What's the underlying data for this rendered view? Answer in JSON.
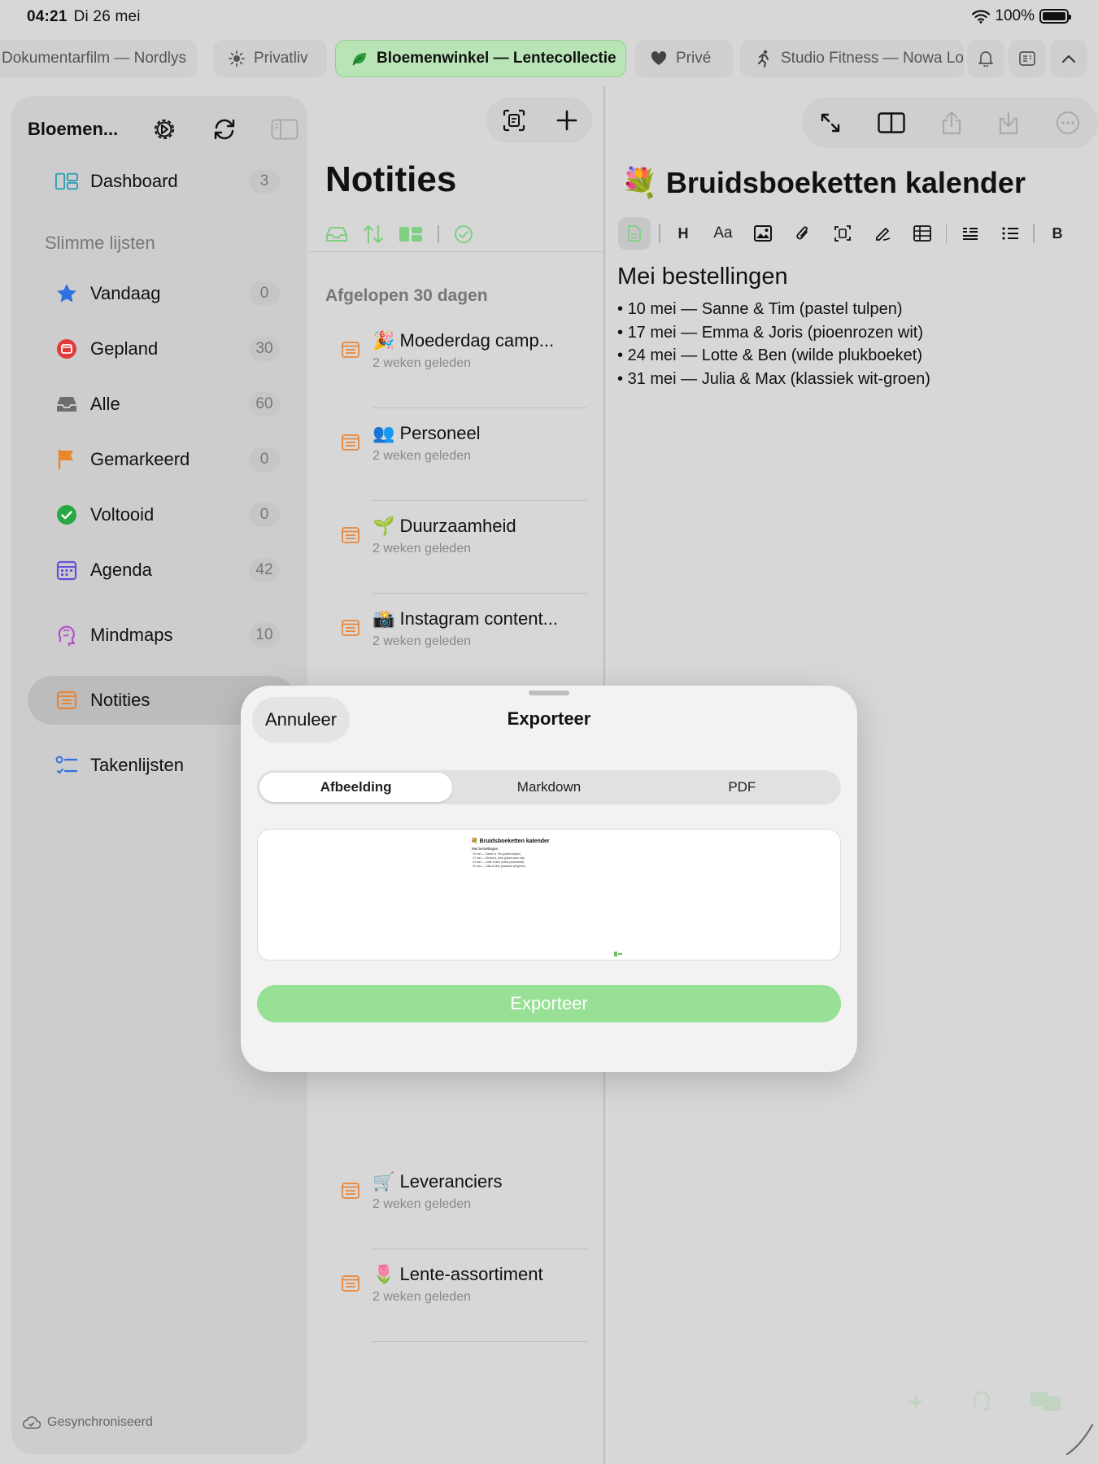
{
  "status": {
    "time": "04:21",
    "date": "Di 26 mei",
    "battery": "100%"
  },
  "tabs": [
    {
      "label": "Dokumentarfilm — Nordlys",
      "icon": "none"
    },
    {
      "label": "Privatliv",
      "icon": "sun-icon"
    },
    {
      "label": "Bloemenwinkel — Lentecollectie",
      "icon": "leaf-icon",
      "active": true
    },
    {
      "label": "Privé",
      "icon": "heart-icon"
    },
    {
      "label": "Studio Fitness — Nowa Lok",
      "icon": "runner-icon"
    }
  ],
  "sidebar": {
    "title": "Bloemen...",
    "section_label": "Slimme lijsten",
    "items": [
      {
        "label": "Dashboard",
        "count": "3"
      },
      {
        "label": "Vandaag",
        "count": "0"
      },
      {
        "label": "Gepland",
        "count": "30"
      },
      {
        "label": "Alle",
        "count": "60"
      },
      {
        "label": "Gemarkeerd",
        "count": "0"
      },
      {
        "label": "Voltooid",
        "count": "0"
      },
      {
        "label": "Agenda",
        "count": "42"
      },
      {
        "label": "Mindmaps",
        "count": "10"
      },
      {
        "label": "Notities",
        "count": ""
      },
      {
        "label": "Takenlijsten",
        "count": ""
      }
    ],
    "sync_status": "Gesynchroniseerd"
  },
  "notes": {
    "title": "Notities",
    "group_label": "Afgelopen 30 dagen",
    "items": [
      {
        "title": "🎉 Moederdag camp...",
        "subtitle": "2 weken geleden"
      },
      {
        "title": "👥 Personeel",
        "subtitle": "2 weken geleden"
      },
      {
        "title": "🌱 Duurzaamheid",
        "subtitle": "2 weken geleden"
      },
      {
        "title": "📸 Instagram content...",
        "subtitle": "2 weken geleden"
      },
      {
        "title": "🛒 Leveranciers",
        "subtitle": "2 weken geleden"
      },
      {
        "title": "🌷 Lente-assortiment",
        "subtitle": "2 weken geleden"
      }
    ]
  },
  "editor": {
    "title": "💐 Bruidsboeketten kalender",
    "heading": "Mei bestellingen",
    "lines": [
      "10 mei — Sanne & Tim (pastel tulpen)",
      "17 mei — Emma & Joris (pioenrozen wit)",
      "24 mei — Lotte & Ben (wilde plukboeket)",
      "31 mei — Julia & Max (klassiek wit-groen)"
    ],
    "format_buttons": [
      "H",
      "Aa",
      "B"
    ]
  },
  "export_dialog": {
    "cancel": "Annuleer",
    "title": "Exporteer",
    "segments": [
      "Afbeelding",
      "Markdown",
      "PDF"
    ],
    "active_segment": "Afbeelding",
    "export_button": "Exporteer"
  },
  "colors": {
    "accent": "#97e096",
    "tab_active_bg": "#b9e5b6",
    "note_icon": "#e8873a"
  }
}
